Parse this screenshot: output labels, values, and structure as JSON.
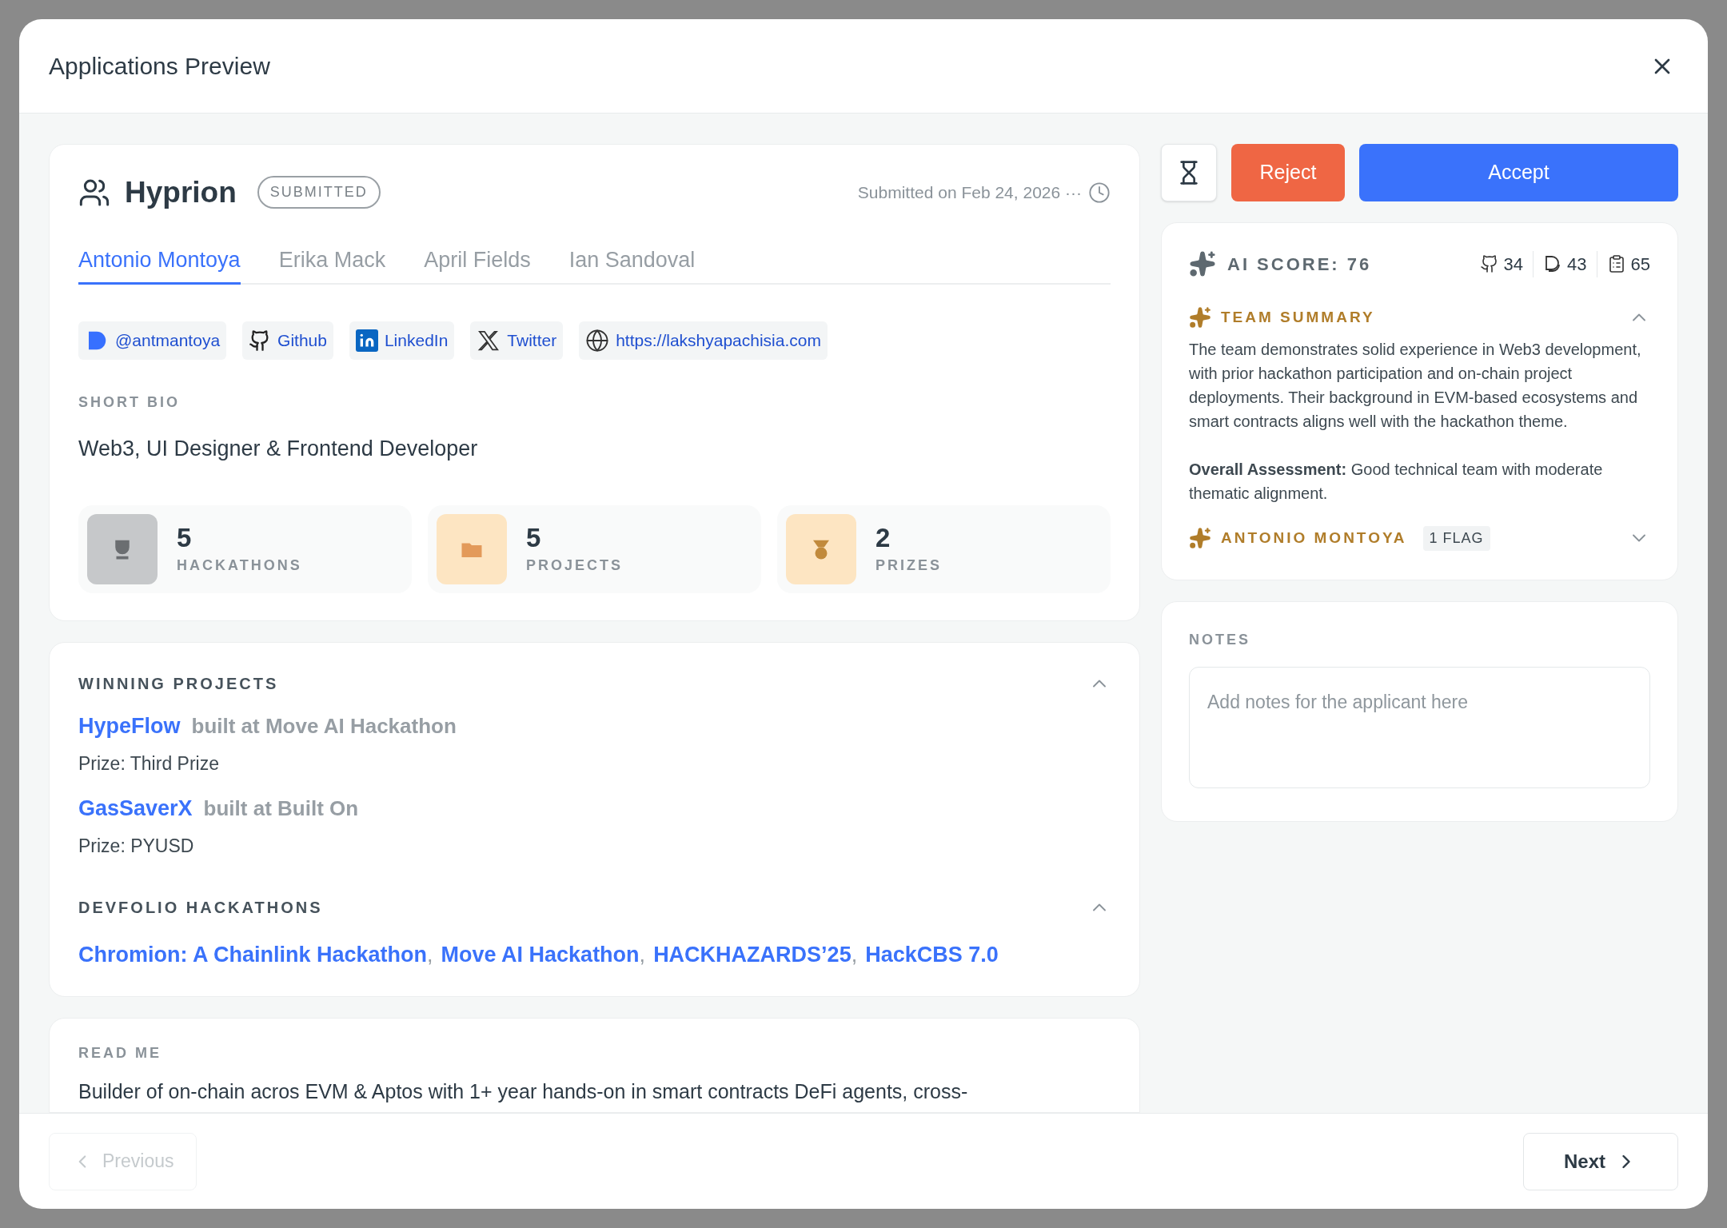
{
  "dialog": {
    "title": "Applications Preview"
  },
  "team": {
    "name": "Hyprion",
    "status": "SUBMITTED",
    "submitted": "Submitted on Feb 24, 2026 ···"
  },
  "member_tabs": [
    {
      "label": "Antonio Montoya",
      "selected": true
    },
    {
      "label": "Erika Mack",
      "selected": false
    },
    {
      "label": "April Fields",
      "selected": false
    },
    {
      "label": "Ian Sandoval",
      "selected": false
    }
  ],
  "links": [
    {
      "kind": "devfolio",
      "label": "@antmantoya"
    },
    {
      "kind": "github",
      "label": "Github"
    },
    {
      "kind": "linkedin",
      "label": "LinkedIn"
    },
    {
      "kind": "twitter",
      "label": "Twitter"
    },
    {
      "kind": "website",
      "label": "https://lakshyapachisia.com"
    }
  ],
  "bio": {
    "heading": "SHORT BIO",
    "text": "Web3, UI Designer & Frontend Developer"
  },
  "stats": [
    {
      "kind": "hackathons",
      "value": "5",
      "label": "HACKATHONS"
    },
    {
      "kind": "projects",
      "value": "5",
      "label": "PROJECTS"
    },
    {
      "kind": "prizes",
      "value": "2",
      "label": "PRIZES"
    }
  ],
  "winning_projects": {
    "heading": "WINNING PROJECTS",
    "expanded": true,
    "items": [
      {
        "name": "HypeFlow",
        "built_at": "built at Move AI Hackathon",
        "prize": "Prize: Third Prize"
      },
      {
        "name": "GasSaverX",
        "built_at": "built at Built On",
        "prize": "Prize: PYUSD"
      }
    ]
  },
  "devfolio_hackathons": {
    "heading": "DEVFOLIO HACKATHONS",
    "expanded": true,
    "separator": ",",
    "items": [
      "Chromion: A Chainlink Hackathon",
      "Move AI Hackathon",
      "HACKHAZARDS’25",
      "HackCBS 7.0"
    ]
  },
  "readme": {
    "heading": "READ ME",
    "text": "Builder of on-chain acros EVM & Aptos with 1+ year hands-on in smart contracts DeFi agents, cross-"
  },
  "actions": [
    {
      "kind": "pending"
    },
    {
      "kind": "reject",
      "label": "Reject"
    },
    {
      "kind": "accept",
      "label": "Accept"
    }
  ],
  "ai_score": {
    "label": "AI SCORE: 76",
    "metrics": [
      {
        "kind": "github",
        "value": "34"
      },
      {
        "kind": "devfolio",
        "value": "43"
      },
      {
        "kind": "clipboard",
        "value": "65"
      }
    ]
  },
  "team_summary": {
    "heading": "TEAM SUMMARY",
    "expanded": true,
    "text": "The team demonstrates solid experience in Web3 development, with prior hackathon participation and on-chain project deployments. Their background in EVM-based ecosystems and smart contracts aligns well with the hackathon theme.",
    "assessment": "**Overall Assessment:** Good technical team with moderate thematic alignment."
  },
  "member_summary": {
    "name": "ANTONIO MONTOYA",
    "flag": "1 FLAG",
    "expanded": false
  },
  "notes": {
    "heading": "NOTES",
    "placeholder": "Add notes for the applicant here"
  },
  "footer": {
    "previous": {
      "label": "Previous",
      "disabled": true
    },
    "next": {
      "label": "Next",
      "disabled": false
    }
  }
}
